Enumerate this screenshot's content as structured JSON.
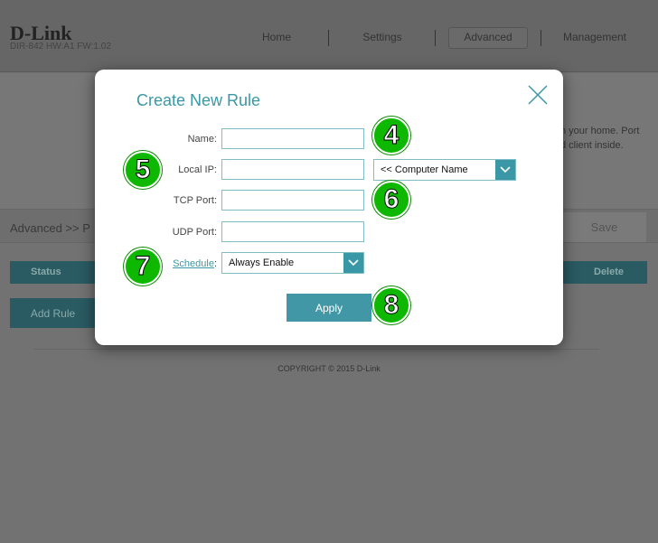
{
  "header": {
    "logo": "D-Link",
    "model": "DIR-842   HW:A1   FW:1.02",
    "nav": [
      {
        "label": "Home"
      },
      {
        "label": "Settings"
      },
      {
        "label": "Advanced"
      },
      {
        "label": "Management"
      }
    ]
  },
  "hero": {
    "text_line1": "n your home. Port",
    "text_line2": "d client inside."
  },
  "breadcrumb": "Advanced >> P",
  "save_label": "Save",
  "table": {
    "status": "Status",
    "delete": "Delete"
  },
  "add_rule": "Add Rule",
  "copyright": "COPYRIGHT © 2015 D-Link",
  "modal": {
    "title": "Create New Rule",
    "name_label": "Name:",
    "name_value": "",
    "localip_label": "Local IP:",
    "localip_value": "",
    "computer_select": "<< Computer Name",
    "tcp_label": "TCP Port:",
    "tcp_value": "",
    "udp_label": "UDP Port:",
    "udp_value": "",
    "schedule_label": "Schedule",
    "schedule_colon": ":",
    "schedule_value": "Always Enable",
    "apply": "Apply"
  },
  "badges": [
    "4",
    "5",
    "6",
    "7",
    "8"
  ],
  "colors": {
    "accent": "#3a98a6",
    "badge": "#0fb800"
  }
}
